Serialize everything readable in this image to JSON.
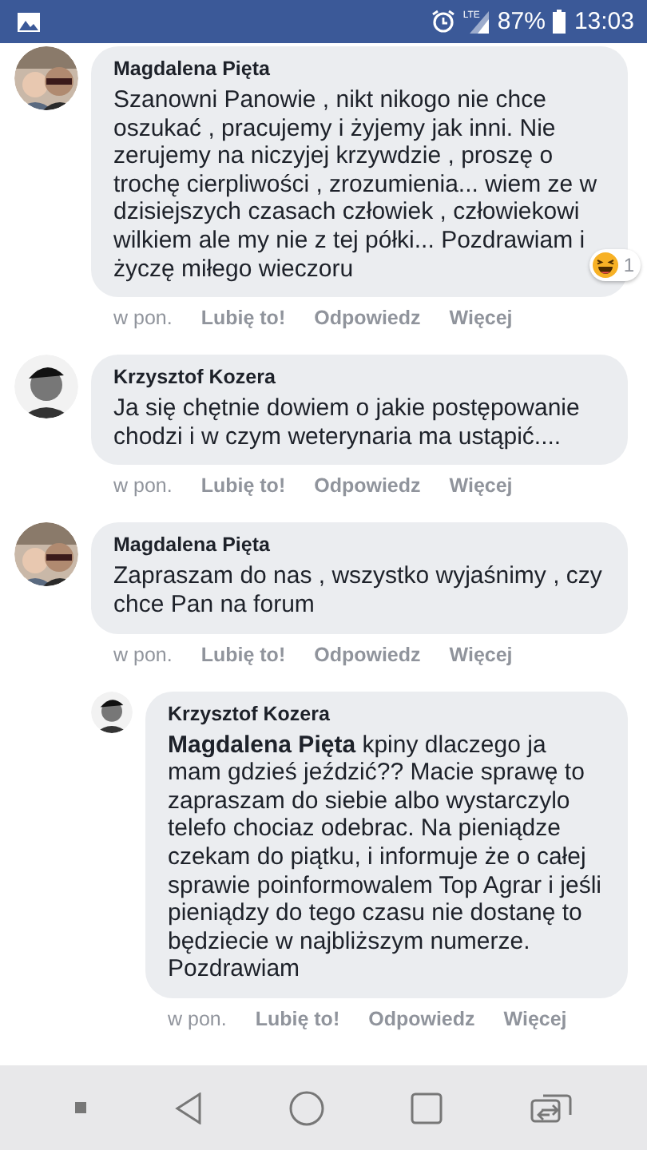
{
  "status_bar": {
    "network": "LTE",
    "battery": "87%",
    "time": "13:03"
  },
  "comments": [
    {
      "author": "Magdalena Pięta",
      "text": "Szanowni Panowie , nikt nikogo nie chce oszukać , pracujemy i żyjemy jak inni. Nie zerujemy na niczyjej krzywdzie , proszę o trochę cierpliwości , zrozumienia... wiem ze w dzisiejszych czasach człowiek , człowiekowi wilkiem ale my nie z tej półki... Pozdrawiam i życzę miłego wieczoru",
      "reaction_count": "1",
      "time": "w pon.",
      "actions": [
        "Lubię to!",
        "Odpowiedz",
        "Więcej"
      ]
    },
    {
      "author": "Krzysztof Kozera",
      "text": "Ja się chętnie dowiem o jakie postępowanie chodzi i w czym weterynaria ma ustąpić....",
      "time": "w pon.",
      "actions": [
        "Lubię to!",
        "Odpowiedz",
        "Więcej"
      ]
    },
    {
      "author": "Magdalena Pięta",
      "text": "Zapraszam do nas , wszystko wyjaśnimy , czy chce Pan na forum",
      "time": "w pon.",
      "actions": [
        "Lubię to!",
        "Odpowiedz",
        "Więcej"
      ],
      "replies": [
        {
          "author": "Krzysztof Kozera",
          "text": "**Magdalena Pięta** kpiny dlaczego ja mam gdzieś jeździć?? Macie sprawę to zapraszam do siebie albo wystarczylo telefo chociaz odebrac. Na pieniądze czekam do piątku, i informuje że o całej sprawie poinformowalem Top Agrar i jeśli pieniądzy do tego czasu nie dostanę to będziecie w najbliższym numerze. Pozdrawiam",
          "time": "w pon.",
          "actions": [
            "Lubię to!",
            "Odpowiedz",
            "Więcej"
          ]
        }
      ]
    }
  ]
}
